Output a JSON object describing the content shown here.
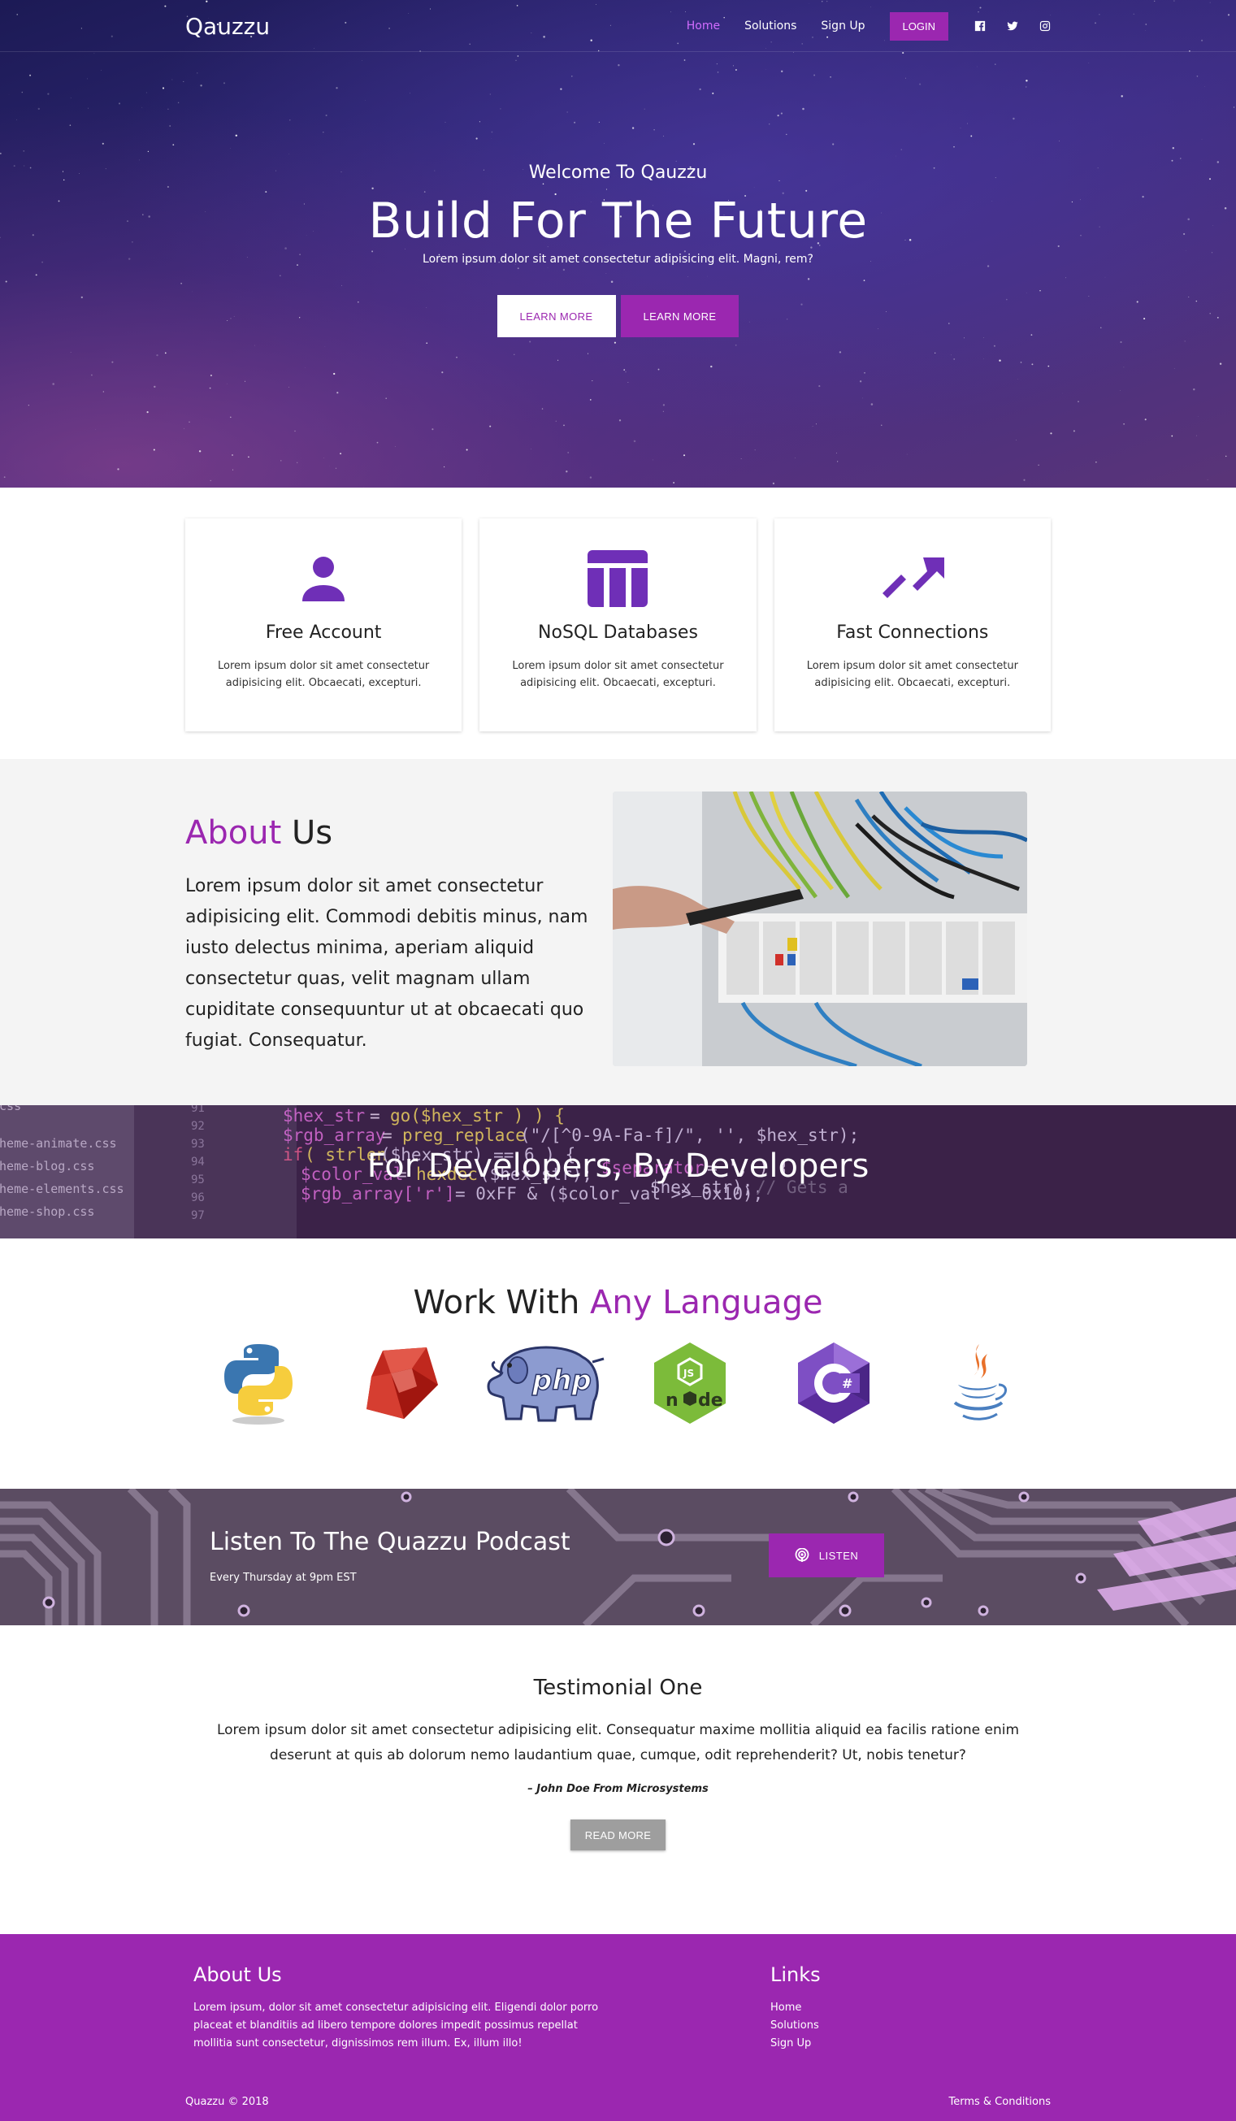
{
  "nav": {
    "brand": "Qauzzu",
    "links": [
      "Home",
      "Solutions",
      "Sign Up"
    ],
    "login_label": "LOGIN",
    "social_icons": [
      "facebook-icon",
      "twitter-icon",
      "instagram-icon"
    ]
  },
  "hero": {
    "eyebrow": "Welcome To Qauzzu",
    "title": "Build For The Future",
    "subtitle": "Lorem ipsum dolor sit amet consectetur adipisicing elit. Magni, rem?",
    "btn_learn_more_white": "LEARN MORE",
    "btn_learn_more_purple": "LEARN MORE"
  },
  "features": [
    {
      "icon": "user-icon",
      "title": "Free Account",
      "text": "Lorem ipsum dolor sit amet consectetur adipisicing elit. Obcaecati, excepturi."
    },
    {
      "icon": "database-columns-icon",
      "title": "NoSQL Databases",
      "text": "Lorem ipsum dolor sit amet consectetur adipisicing elit. Obcaecati, excepturi."
    },
    {
      "icon": "trending-up-icon",
      "title": "Fast Connections",
      "text": "Lorem ipsum dolor sit amet consectetur adipisicing elit. Obcaecati, excepturi."
    }
  ],
  "about": {
    "title_accent": "About",
    "title_rest": " Us",
    "body": "Lorem ipsum dolor sit amet consectetur adipisicing elit. Commodi debitis minus, nam iusto delectus minima, aperiam aliquid consectetur quas, velit magnam ullam cupiditate consequuntur ut at obcaecati quo fugiat. Consequatur."
  },
  "dev_banner": {
    "title": "For Developers, By Developers"
  },
  "languages": {
    "title_plain": "Work With ",
    "title_accent": "Any Language",
    "items": [
      "python-logo",
      "ruby-logo",
      "php-logo",
      "nodejs-logo",
      "csharp-logo",
      "java-logo"
    ]
  },
  "podcast": {
    "title": "Listen To The Quazzu Podcast",
    "subtitle": "Every Thursday at 9pm EST",
    "button_label": "LISTEN"
  },
  "testimonial": {
    "title": "Testimonial One",
    "body": "Lorem ipsum dolor sit amet consectetur adipisicing elit. Consequatur maxime mollitia aliquid ea facilis ratione enim deserunt at quis ab dolorum nemo laudantium quae, cumque, odit reprehenderit? Ut, nobis tenetur?",
    "author": "– John Doe From Microsystems",
    "button_label": "READ MORE"
  },
  "footer": {
    "about_heading": "About Us",
    "about_text": "Lorem ipsum, dolor sit amet consectetur adipisicing elit. Eligendi dolor porro placeat et blanditiis ad libero tempore dolores impedit possimus repellat mollitia sunt consectetur, dignissimos rem illum. Ex, illum illo!",
    "links_heading": "Links",
    "links": [
      "Home",
      "Solutions",
      "Sign Up"
    ],
    "copyright": "Quazzu © 2018",
    "terms": "Terms & Conditions"
  },
  "colors": {
    "accent": "#9b27b0",
    "icon_purple": "#6f2fb7",
    "nav_active": "#d26cff"
  }
}
